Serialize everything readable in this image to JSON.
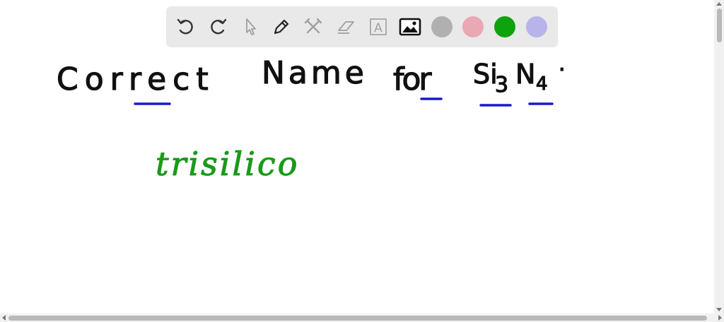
{
  "toolbar": {
    "tools": [
      {
        "name": "undo-icon"
      },
      {
        "name": "redo-icon"
      },
      {
        "name": "pointer-icon"
      },
      {
        "name": "pencil-icon"
      },
      {
        "name": "tools-icon"
      },
      {
        "name": "eraser-icon"
      },
      {
        "name": "text-icon",
        "label": "A"
      },
      {
        "name": "image-icon"
      }
    ],
    "colors": [
      {
        "name": "gray",
        "hex": "#b0b0b0"
      },
      {
        "name": "pink",
        "hex": "#e9a8b4"
      },
      {
        "name": "green",
        "hex": "#0ca30c"
      },
      {
        "name": "lavender",
        "hex": "#b7b4ec"
      }
    ]
  },
  "board": {
    "line1": {
      "part1": "Correct",
      "part2": "Name",
      "part3": "for",
      "formula_el1": "Si",
      "formula_sub1": "3",
      "formula_el2": "N",
      "formula_sub2": "4",
      "end": "."
    },
    "line2": "trisilico",
    "ink_black": "#111111",
    "ink_blue": "#1a1acc",
    "ink_green": "#1a9a1a"
  }
}
